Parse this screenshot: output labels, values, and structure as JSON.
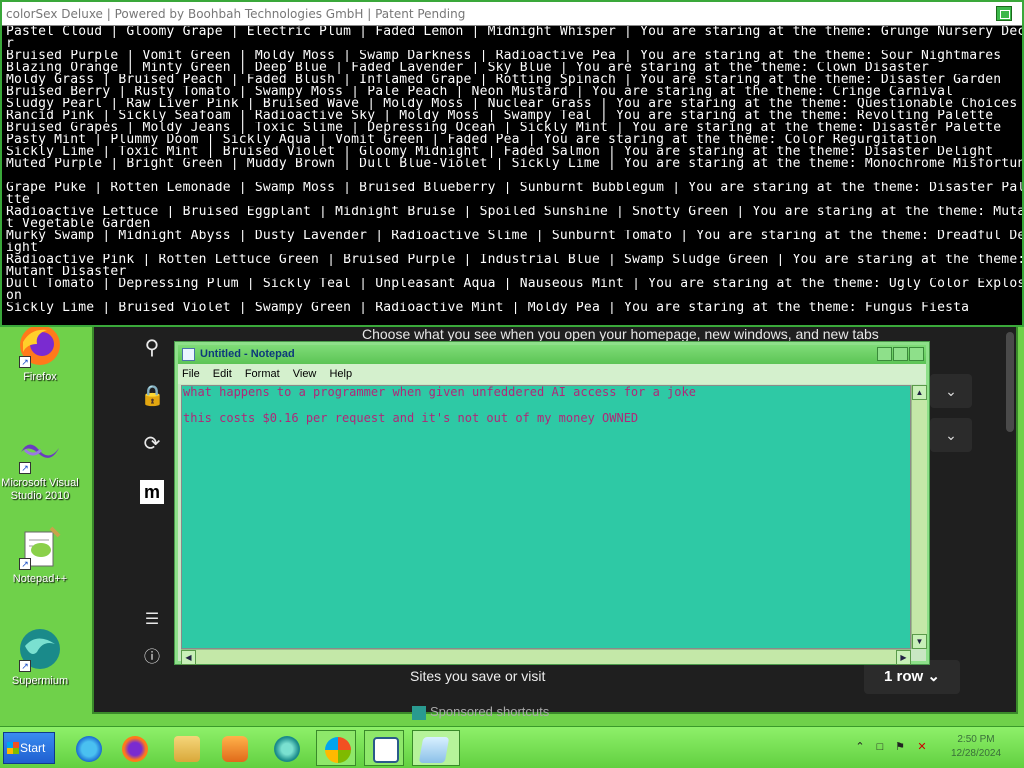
{
  "console": {
    "title": "colorSex Deluxe | Powered by Boohbah Technologies GmbH | Patent Pending",
    "lines": [
      "Pastel Cloud | Gloomy Grape | Electric Plum | Faded Lemon | Midnight Whisper | You are staring at the theme: Grunge Nursery Deco",
      "r",
      "Bruised Purple | Vomit Green | Moldy Moss | Swamp Darkness | Radioactive Pea | You are staring at the theme: Sour Nightmares",
      "Blazing Orange | Minty Green | Deep Blue | Faded Lavender | Sky Blue | You are staring at the theme: Clown Disaster",
      "Moldy Grass | Bruised Peach | Faded Blush | Inflamed Grape | Rotting Spinach | You are staring at the theme: Disaster Garden",
      "Bruised Berry | Rusty Tomato | Swampy Moss | Pale Peach | Neon Mustard | You are staring at the theme: Cringe Carnival",
      "Sludgy Pearl | Raw Liver Pink | Bruised Wave | Moldy Moss | Nuclear Grass | You are staring at the theme: Questionable Choices",
      "Rancid Pink | Sickly Seafoam | Radioactive Sky | Moldy Moss | Swampy Teal | You are staring at the theme: Revolting Palette",
      "Bruised Grapes | Moldy Jeans | Toxic Slime | Depressing Ocean | Sickly Mint | You are staring at the theme: Disaster Palette",
      "Pasty Mint | Plummy Doom | Sickly Aqua | Vomit Green | Faded Pea | You are staring at the theme: Color Regurgitation",
      "Sickly Lime | Toxic Mint | Bruised Violet | Gloomy Midnight | Faded Salmon | You are staring at the theme: Disaster Delight",
      "Muted Purple | Bright Green | Muddy Brown | Dull Blue-Violet | Sickly Lime | You are staring at the theme: Monochrome Misfortune",
      "",
      "Grape Puke | Rotten Lemonade | Swamp Moss | Bruised Blueberry | Sunburnt Bubblegum | You are staring at the theme: Disaster Pale",
      "tte",
      "Radioactive Lettuce | Bruised Eggplant | Midnight Bruise | Spoiled Sunshine | Snotty Green | You are staring at the theme: Mutan",
      "t Vegetable Garden",
      "Murky Swamp | Midnight Abyss | Dusty Lavender | Radioactive Slime | Sunburnt Tomato | You are staring at the theme: Dreadful Del",
      "ight",
      "Radioactive Pink | Rotten Lettuce Green | Bruised Purple | Industrial Blue | Swamp Sludge Green | You are staring at the theme:",
      "Mutant Disaster",
      "Dull Tomato | Depressing Plum | Sickly Teal | Unpleasant Aqua | Nauseous Mint | You are staring at the theme: Ugly Color Explosi",
      "on",
      "Sickly Lime | Bruised Violet | Swampy Green | Radioactive Mint | Moldy Pea | You are staring at the theme: Fungus Fiesta"
    ]
  },
  "browser": {
    "top_text": "Choose what you see when you open your homepage, new windows, and new tabs",
    "sites_label": "Sites you save or visit",
    "row_label": "1 row",
    "sponsored_label": "Sponsored shortcuts",
    "dropdown_glyph": "⌄"
  },
  "notepad": {
    "title": "Untitled - Notepad",
    "menu": [
      "File",
      "Edit",
      "Format",
      "View",
      "Help"
    ],
    "lines": [
      "what happens to a programmer when given unfeddered AI access for a joke",
      "",
      "this costs $0.16 per request and it's not out of my money OWNED"
    ]
  },
  "desktop_icons": [
    {
      "label": "Firefox"
    },
    {
      "label": "Microsoft Visual Studio 2010"
    },
    {
      "label": "Notepad++"
    },
    {
      "label": "Supermium"
    }
  ],
  "taskbar": {
    "start_label": "Start",
    "clock_time": "2:50 PM",
    "clock_date": "12/28/2024"
  },
  "colors": {
    "desktop": "#6fd14a",
    "notepad_bg": "#2ec9a5",
    "notepad_text": "#b02878",
    "console_bg": "#000000"
  }
}
